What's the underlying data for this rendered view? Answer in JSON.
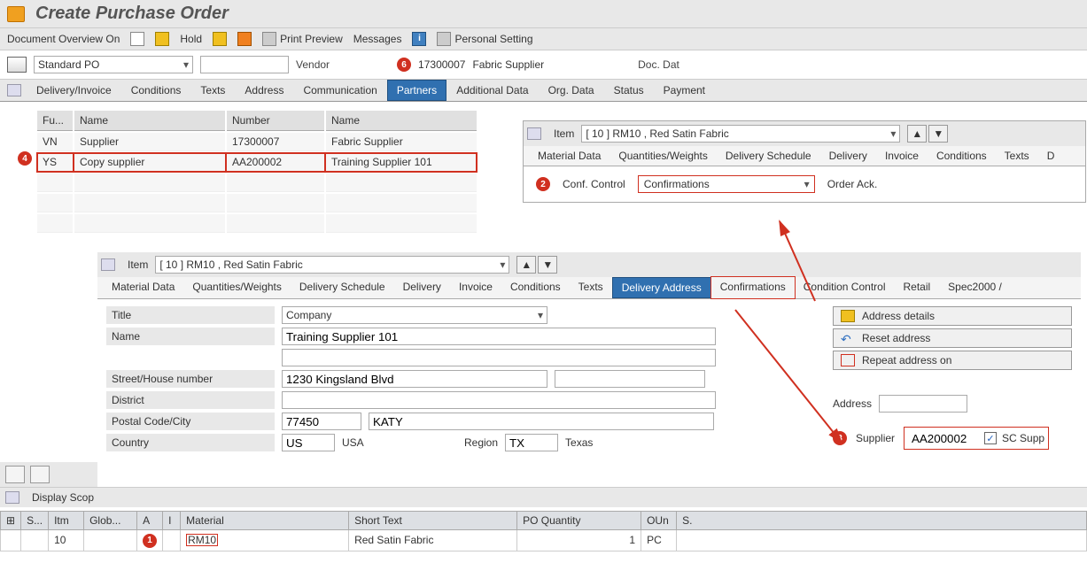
{
  "header": {
    "title": "Create Purchase Order"
  },
  "toolbar": {
    "doc_overview": "Document Overview On",
    "hold": "Hold",
    "print_preview": "Print Preview",
    "messages": "Messages",
    "personal_setting": "Personal Setting"
  },
  "po": {
    "type": "Standard PO",
    "vendor_label": "Vendor",
    "vendor_code": "17300007",
    "vendor_name": "Fabric  Supplier",
    "doc_date": "Doc. Dat"
  },
  "main_tabs": [
    "Delivery/Invoice",
    "Conditions",
    "Texts",
    "Address",
    "Communication",
    "Partners",
    "Additional Data",
    "Org. Data",
    "Status",
    "Payment"
  ],
  "partners": {
    "headers": {
      "fu": "Fu...",
      "name1": "Name",
      "number": "Number",
      "name2": "Name"
    },
    "rows": [
      {
        "fu": "VN",
        "name1": "Supplier",
        "number": "17300007",
        "name2": "Fabric Supplier"
      },
      {
        "fu": "YS",
        "name1": "Copy supplier",
        "number": "AA200002",
        "name2": "Training Supplier 101"
      }
    ]
  },
  "item1": {
    "label": "Item",
    "value": "[ 10 ] RM10 , Red Satin Fabric",
    "tabs": [
      "Material Data",
      "Quantities/Weights",
      "Delivery Schedule",
      "Delivery",
      "Invoice",
      "Conditions",
      "Texts",
      "Delivery Address",
      "Confirmations",
      "Condition Control",
      "Retail",
      "Spec2000 /"
    ]
  },
  "item2": {
    "label": "Item",
    "value": "[ 10 ] RM10 , Red Satin Fabric",
    "tabs": [
      "Material Data",
      "Quantities/Weights",
      "Delivery Schedule",
      "Delivery",
      "Invoice",
      "Conditions",
      "Texts",
      "D"
    ]
  },
  "conf": {
    "label": "Conf. Control",
    "value": "Confirmations",
    "order_ack": "Order Ack."
  },
  "address": {
    "title_label": "Title",
    "title_value": "Company",
    "name_label": "Name",
    "name_value": "Training Supplier 101",
    "street_label": "Street/House number",
    "street_value": "1230 Kingsland Blvd",
    "district_label": "District",
    "postal_label": "Postal Code/City",
    "postal_value": "77450",
    "city_value": "KATY",
    "country_label": "Country",
    "country_code": "US",
    "country_name": "USA",
    "region_label": "Region",
    "region_code": "TX",
    "region_name": "Texas",
    "buttons": {
      "details": "Address details",
      "reset": "Reset address",
      "repeat": "Repeat address on"
    },
    "address_label": "Address",
    "supplier_label": "Supplier",
    "supplier_value": "AA200002",
    "sc_supp": "SC Supp"
  },
  "display_scope": "Display Scop",
  "grid": {
    "headers": [
      "S...",
      "Itm",
      "Glob...",
      "A",
      "I",
      "Material",
      "Short Text",
      "PO Quantity",
      "OUn",
      "S."
    ],
    "row": {
      "itm": "10",
      "material": "RM10",
      "short_text": "Red Satin Fabric",
      "qty": "1",
      "oun": "PC"
    }
  },
  "badges": {
    "b1": "1",
    "b2": "2",
    "b3": "3",
    "b4": "4",
    "b6": "6"
  }
}
